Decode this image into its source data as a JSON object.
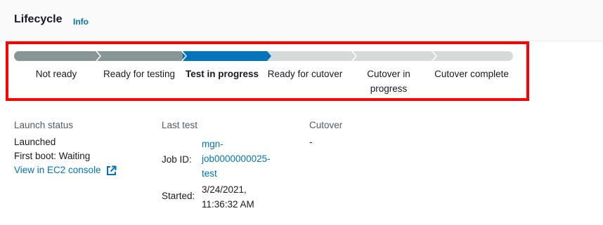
{
  "header": {
    "title": "Lifecycle",
    "info_label": "Info"
  },
  "lifecycle": {
    "steps": [
      {
        "label": "Not ready",
        "state": "complete"
      },
      {
        "label": "Ready for testing",
        "state": "complete"
      },
      {
        "label": "Test in progress",
        "state": "current"
      },
      {
        "label": "Ready for cutover",
        "state": "pending"
      },
      {
        "label": "Cutover in progress",
        "state": "pending"
      },
      {
        "label": "Cutover complete",
        "state": "pending"
      }
    ],
    "colors": {
      "complete": "#879596",
      "current": "#0073bb",
      "pending": "#d5dbdb",
      "highlight": "#ff0000"
    }
  },
  "details": {
    "launch_status": {
      "heading": "Launch status",
      "status": "Launched",
      "first_boot": "First boot: Waiting",
      "console_link": "View in EC2 console"
    },
    "last_test": {
      "heading": "Last test",
      "job_id_label": "Job ID:",
      "job_id_lines": [
        "mgn-",
        "job0000000025-",
        "test"
      ],
      "started_label": "Started:",
      "started_lines": [
        "3/24/2021,",
        "11:36:32 AM"
      ]
    },
    "cutover": {
      "heading": "Cutover",
      "value": "-"
    }
  }
}
